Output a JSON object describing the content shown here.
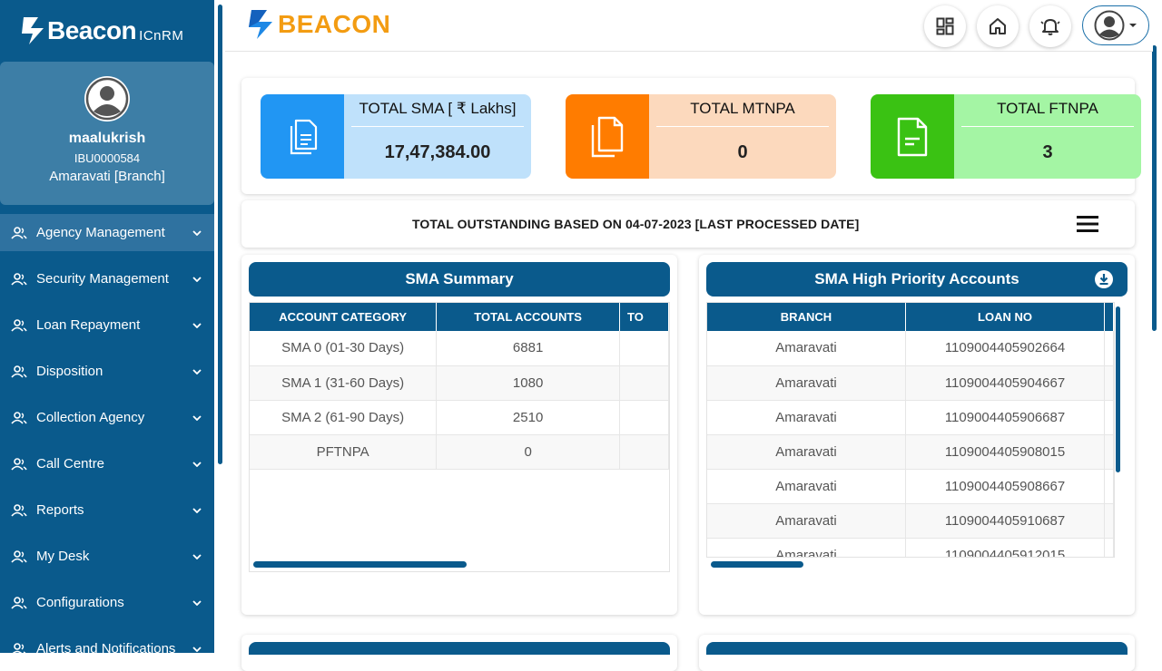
{
  "sidebar": {
    "brand_name": "Beacon",
    "brand_sub": "ICnRM",
    "user_name": "maalukrish",
    "user_id": "IBU0000584",
    "user_branch": "Amaravati [Branch]",
    "items": [
      {
        "label": "Agency Management",
        "active": true
      },
      {
        "label": "Security Management"
      },
      {
        "label": "Loan Repayment"
      },
      {
        "label": "Disposition"
      },
      {
        "label": "Collection Agency"
      },
      {
        "label": "Call Centre"
      },
      {
        "label": "Reports"
      },
      {
        "label": "My Desk"
      },
      {
        "label": "Configurations"
      },
      {
        "label": "Alerts and Notifications"
      }
    ]
  },
  "header": {
    "logo_text": "BEACON",
    "icons": [
      "dashboard-icon",
      "home-icon",
      "bell-icon",
      "user-avatar-icon"
    ]
  },
  "stats": [
    {
      "title": "TOTAL SMA [ ₹ Lakhs]",
      "value": "17,47,384.00",
      "icon_bg": "#2196f3",
      "body_bg": "#bfe1fb"
    },
    {
      "title": "TOTAL MTNPA",
      "value": "0",
      "icon_bg": "#ff7c00",
      "body_bg": "#fcd9bd"
    },
    {
      "title": "TOTAL FTNPA",
      "value": "3",
      "icon_bg": "#3ac213",
      "body_bg": "#a4f5a4"
    }
  ],
  "outstanding": {
    "text": "TOTAL OUTSTANDING BASED ON 04-07-2023 [LAST PROCESSED DATE]"
  },
  "sma_summary": {
    "title": "SMA Summary",
    "columns": [
      "ACCOUNT CATEGORY",
      "TOTAL ACCOUNTS",
      "TO"
    ],
    "rows": [
      [
        "SMA 0 (01-30 Days)",
        "6881",
        ""
      ],
      [
        "SMA 1 (31-60 Days)",
        "1080",
        ""
      ],
      [
        "SMA 2 (61-90 Days)",
        "2510",
        ""
      ],
      [
        "PFTNPA",
        "0",
        ""
      ]
    ]
  },
  "sma_high_priority": {
    "title": "SMA High Priority Accounts",
    "columns": [
      "BRANCH",
      "LOAN NO"
    ],
    "rows": [
      [
        "Amaravati",
        "1109004405902664"
      ],
      [
        "Amaravati",
        "1109004405904667"
      ],
      [
        "Amaravati",
        "1109004405906687"
      ],
      [
        "Amaravati",
        "1109004405908015"
      ],
      [
        "Amaravati",
        "1109004405908667"
      ],
      [
        "Amaravati",
        "1109004405910687"
      ],
      [
        "Amaravati",
        "1109004405912015"
      ]
    ]
  },
  "colors": {
    "primary": "#0a5a8c",
    "profile_bg": "#3d7ea6",
    "accent_orange": "#f39c12"
  }
}
